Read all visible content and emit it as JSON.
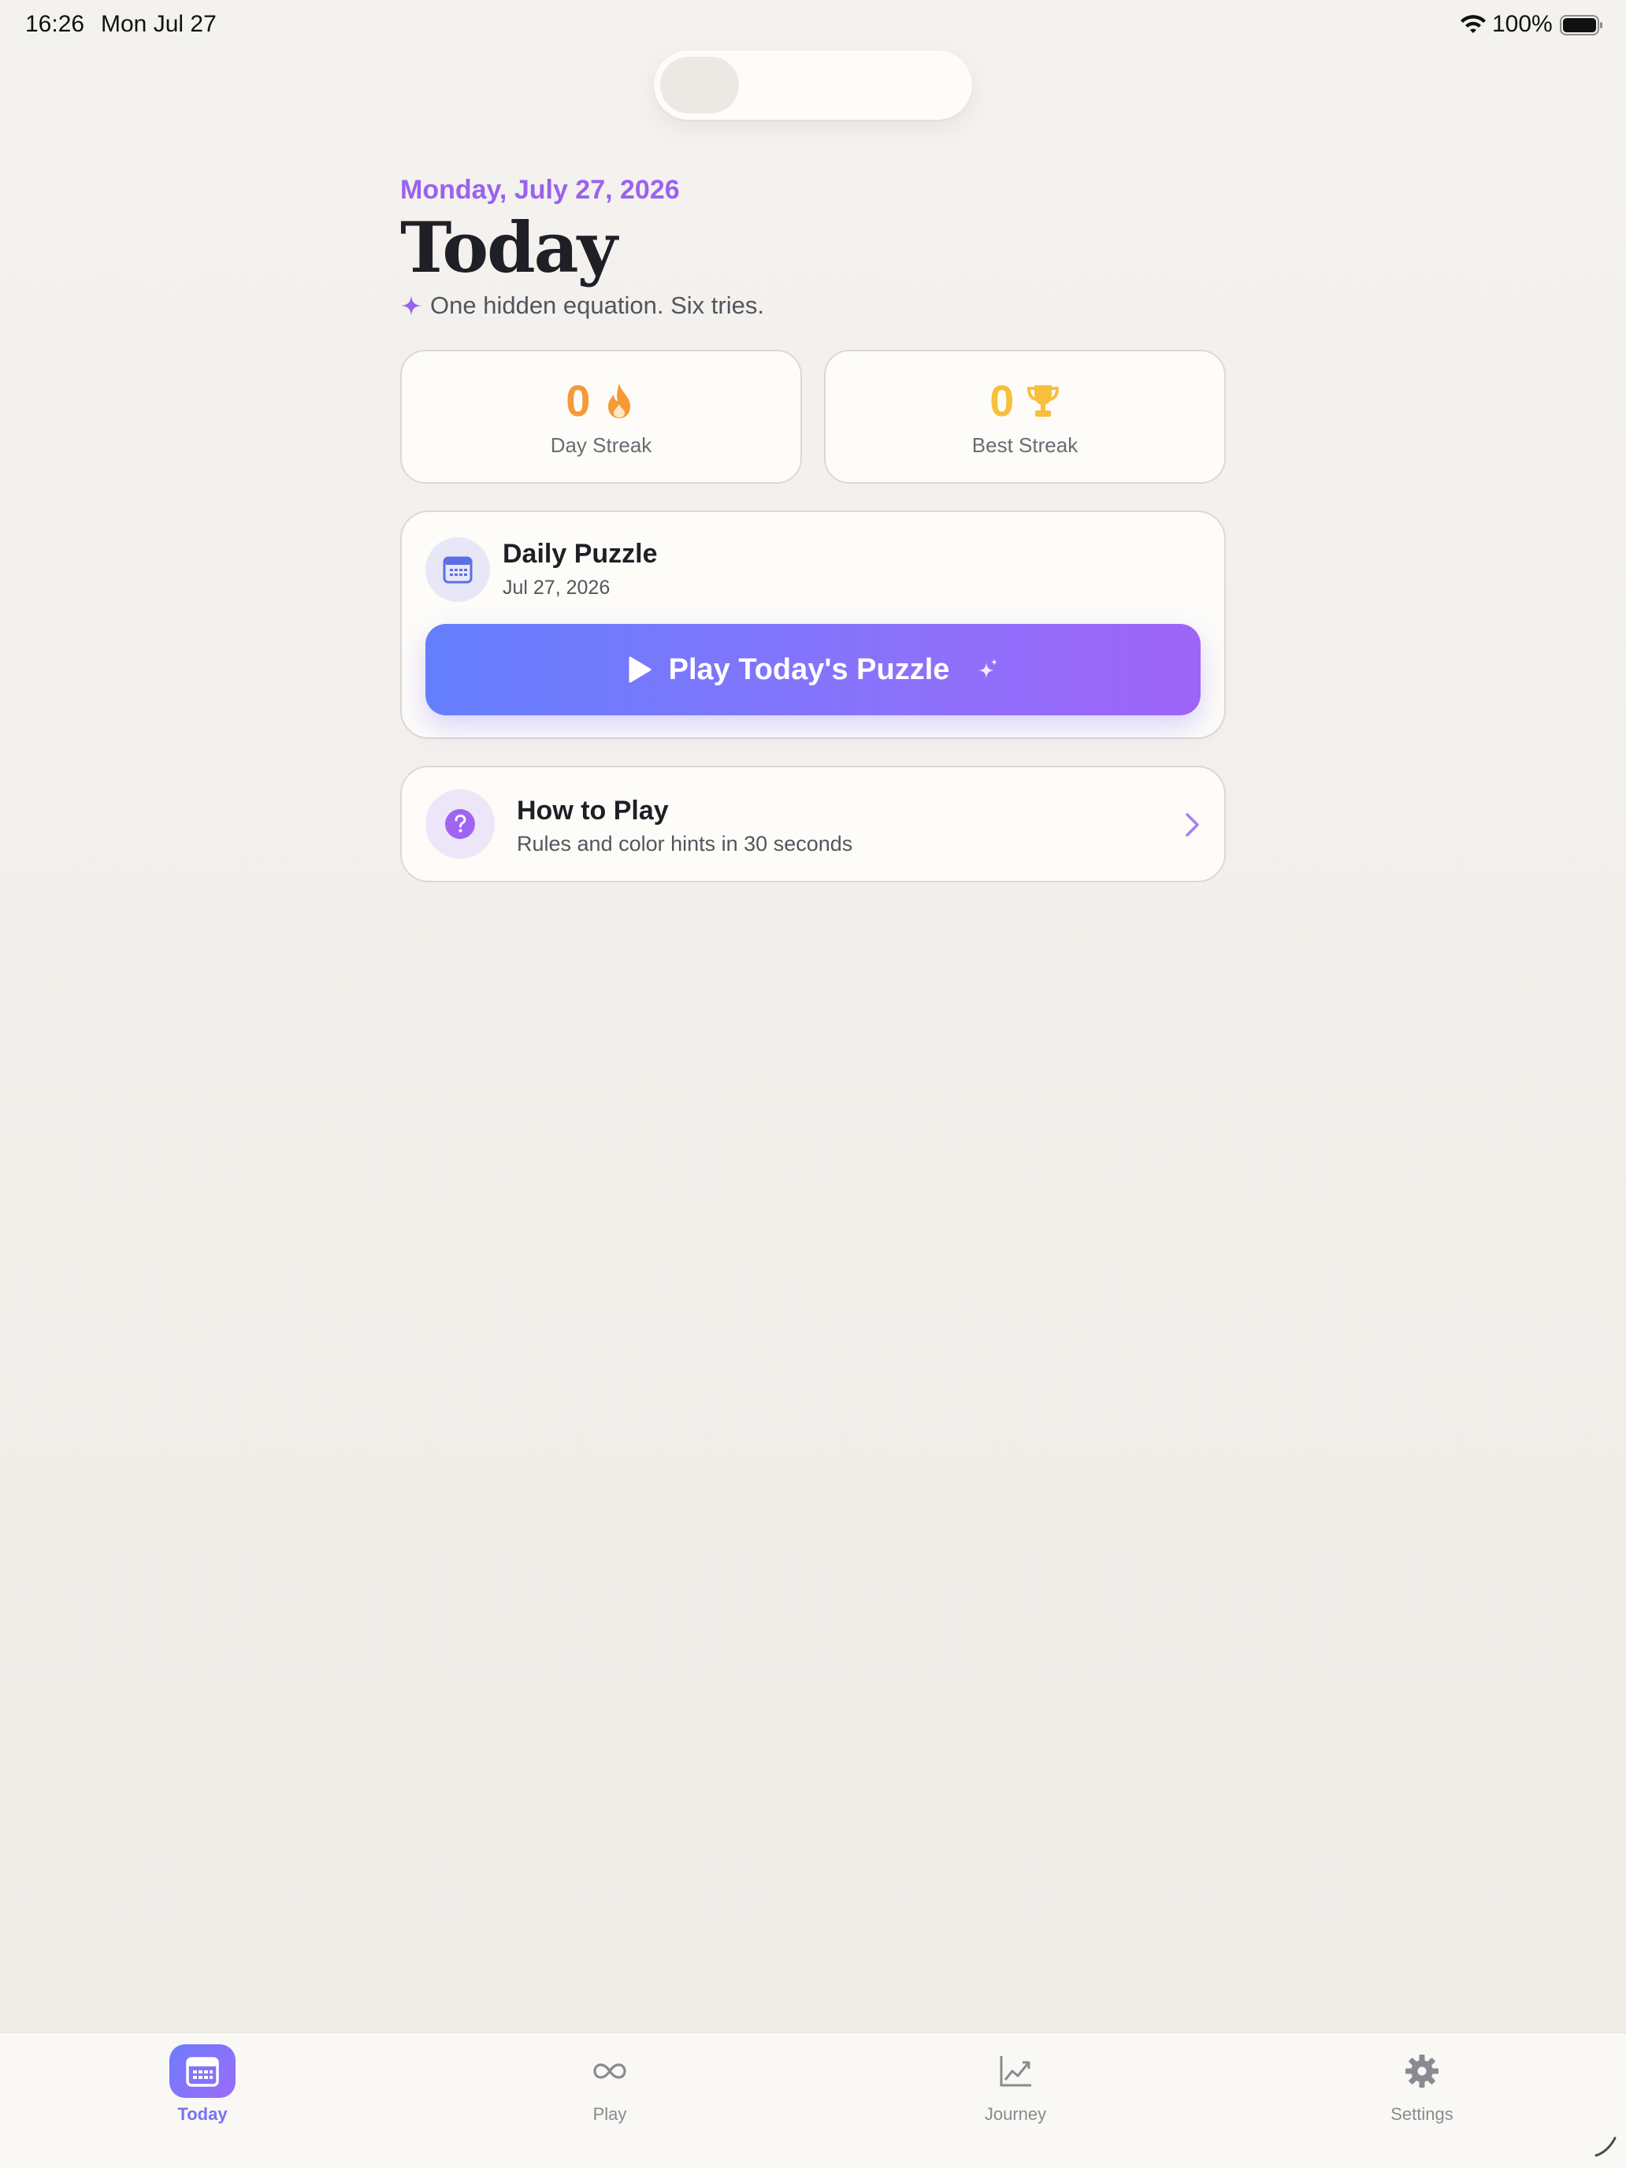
{
  "status_bar": {
    "time": "16:26",
    "date": "Mon Jul 27",
    "battery": "100%",
    "icons": [
      "wifi-icon",
      "battery-icon"
    ]
  },
  "header": {
    "date_line": "Monday, July 27, 2026",
    "title": "Today",
    "subtitle": "One hidden equation. Six tries."
  },
  "stats": {
    "day_streak": {
      "value": "0",
      "label": "Day Streak",
      "icon": "flame-icon"
    },
    "best_streak": {
      "value": "0",
      "label": "Best Streak",
      "icon": "trophy-icon"
    }
  },
  "daily_puzzle": {
    "title": "Daily Puzzle",
    "date": "Jul 27, 2026",
    "icon": "calendar-icon",
    "play_label": "Play Today's Puzzle"
  },
  "how_to_play": {
    "title": "How to Play",
    "subtitle": "Rules and color hints in 30 seconds",
    "icon": "question-icon"
  },
  "tabs": [
    {
      "label": "Today",
      "icon": "calendar-icon",
      "active": true
    },
    {
      "label": "Play",
      "icon": "infinity-icon",
      "active": false
    },
    {
      "label": "Journey",
      "icon": "chart-icon",
      "active": false
    },
    {
      "label": "Settings",
      "icon": "gear-icon",
      "active": false
    }
  ],
  "colors": {
    "accent_purple": "#9a62ef",
    "streak_orange": "#f59a36",
    "trophy_yellow": "#f7bf3c",
    "button_gradient_start": "#637ffc",
    "button_gradient_end": "#9e63f8"
  }
}
